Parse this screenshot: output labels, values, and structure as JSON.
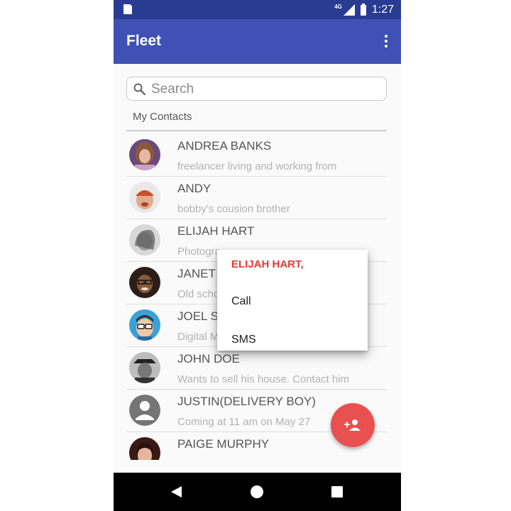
{
  "status_bar": {
    "network": "4G",
    "time": "1:27"
  },
  "app_bar": {
    "title": "Fleet",
    "menu_icon": "more-vert-icon"
  },
  "search": {
    "placeholder": "Search",
    "value": "",
    "icon": "search-icon"
  },
  "section_label": "My Contacts",
  "contacts": [
    {
      "name": "ANDREA BANKS",
      "subtitle": "freelancer living and working from",
      "avatar": "photo-woman-brown-hair"
    },
    {
      "name": "ANDY",
      "subtitle": "bobby's cousion brother",
      "avatar": "photo-man-beanie"
    },
    {
      "name": "ELIJAH HART",
      "subtitle": "Photogra",
      "avatar": "photo-woman-bw"
    },
    {
      "name": "JANET",
      "subtitle": "Old scho",
      "avatar": "photo-woman-glasses"
    },
    {
      "name": "JOEL S",
      "subtitle": "Digital M",
      "avatar": "cartoon-man-glasses"
    },
    {
      "name": "JOHN DOE",
      "subtitle": "Wants to sell his house. Contact him",
      "avatar": "photo-man-hat-bw"
    },
    {
      "name": "JUSTIN(DELIVERY BOY)",
      "subtitle": "Coming at 11 am on May 27",
      "avatar": "default-person-icon"
    },
    {
      "name": "PAIGE MURPHY",
      "subtitle": "",
      "avatar": "photo-woman-dark-hair"
    }
  ],
  "context_menu": {
    "title": "ELIJAH HART,",
    "items": [
      "Call",
      "SMS"
    ]
  },
  "fab": {
    "icon": "add-person-icon"
  },
  "nav_bar": {
    "back_icon": "back-icon",
    "home_icon": "home-icon",
    "recents_icon": "recents-icon"
  },
  "colors": {
    "primary": "#3f51b5",
    "primary_dark": "#2a3c92",
    "accent": "#e85150",
    "menu_title": "#e53935"
  }
}
